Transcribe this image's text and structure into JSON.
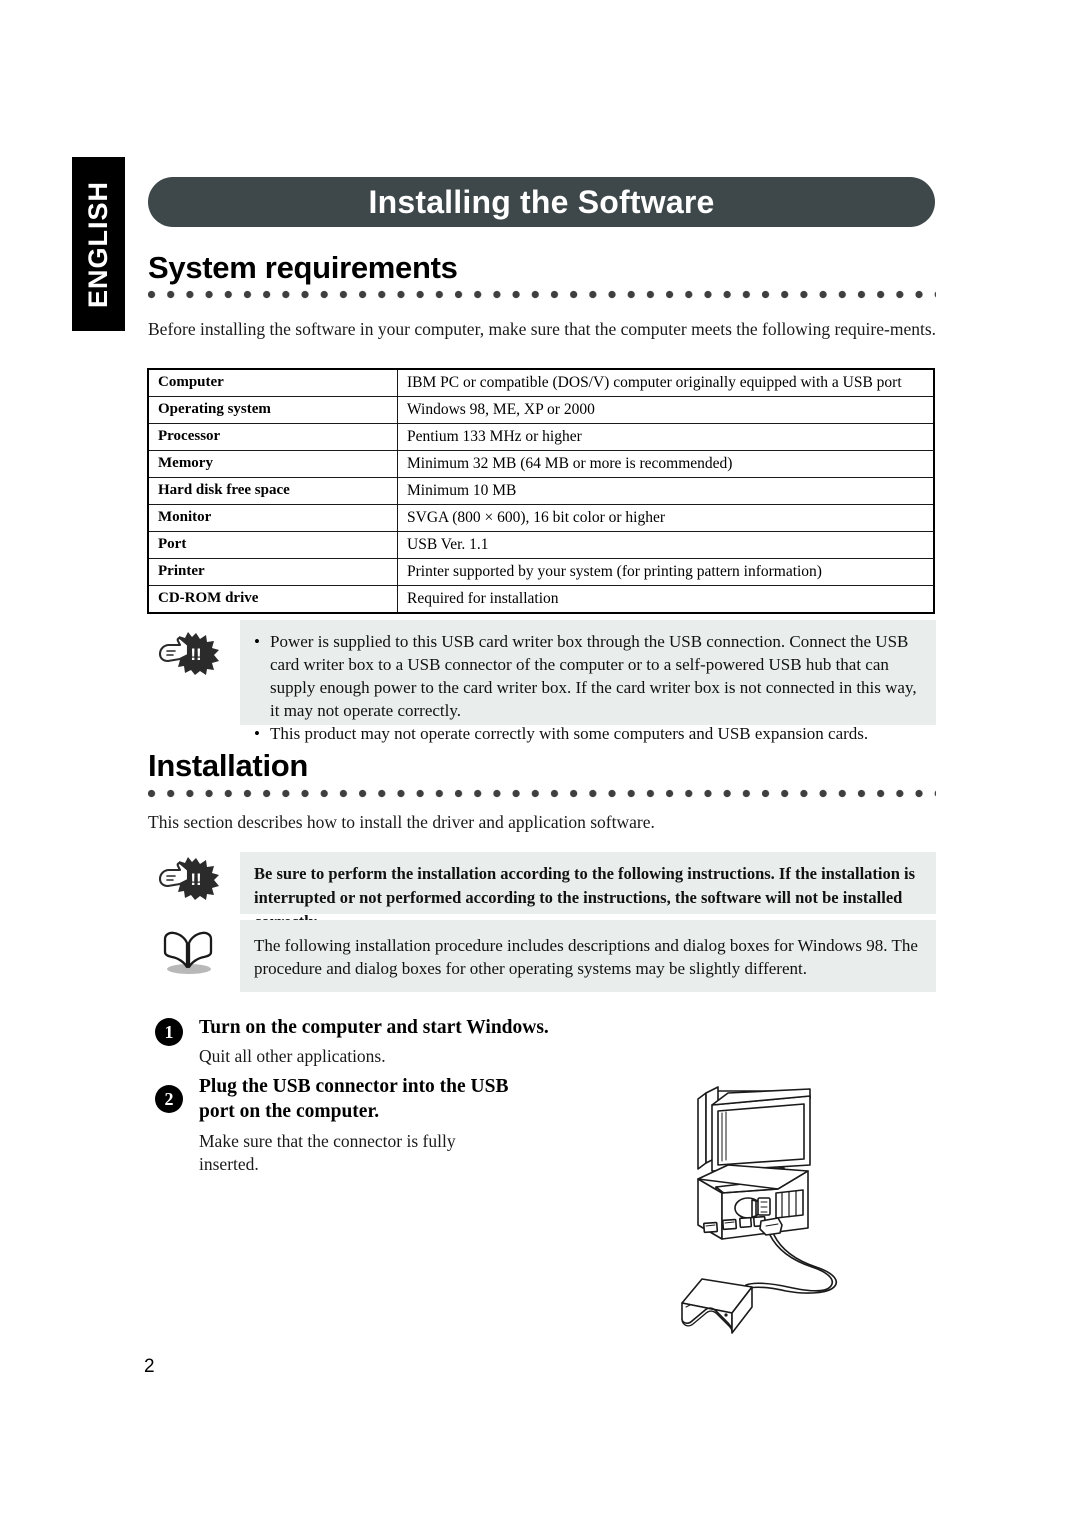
{
  "document": {
    "language_tab": "ENGLISH",
    "banner_title": "Installing the Software",
    "page_number": "2"
  },
  "sections": {
    "system_requirements": {
      "heading": "System requirements",
      "intro": "Before installing the software in your computer, make sure that the computer meets the following require-ments.",
      "table": {
        "rows": [
          {
            "key": "Computer",
            "value": "IBM PC or compatible (DOS/V) computer originally equipped with a USB port"
          },
          {
            "key": "Operating system",
            "value": "Windows 98, ME, XP or 2000"
          },
          {
            "key": "Processor",
            "value": "Pentium 133 MHz or higher"
          },
          {
            "key": "Memory",
            "value": "Minimum 32 MB (64 MB or more is recommended)"
          },
          {
            "key": "Hard disk free space",
            "value": "Minimum 10 MB"
          },
          {
            "key": "Monitor",
            "value": "SVGA (800 × 600), 16 bit color or higher"
          },
          {
            "key": "Port",
            "value": "USB Ver. 1.1"
          },
          {
            "key": "Printer",
            "value": "Printer supported by your system (for printing pattern information)"
          },
          {
            "key": "CD-ROM drive",
            "value": "Required for installation"
          }
        ]
      },
      "notice": {
        "icon": "warning-hand-icon",
        "bullet_marker": "•",
        "bullets": [
          "Power is supplied to this USB card writer box through the USB connection. Connect the USB card writer box to a USB connector of the computer or to a self-powered USB hub that can supply enough power to the card writer box. If the card writer box is not connected in this way, it may not operate correctly.",
          "This product may not operate correctly with some computers and USB expansion cards."
        ]
      }
    },
    "installation": {
      "heading": "Installation",
      "intro": "This section describes how to install the driver and application software.",
      "warning_notice": {
        "icon": "warning-hand-icon",
        "text": "Be sure to perform the installation according to the following instructions. If the installation is interrupted or not performed according to the instructions, the software will not be installed correctly."
      },
      "info_notice": {
        "icon": "open-book-icon",
        "text": "The following installation procedure includes descriptions and dialog boxes for Windows 98. The procedure and dialog boxes for other operating systems may be slightly different."
      },
      "steps": [
        {
          "number": "1",
          "title": "Turn on the computer and start Windows.",
          "body": "Quit all other applications."
        },
        {
          "number": "2",
          "title": "Plug the USB connector into the USB port on the computer.",
          "body": "Make sure that the connector is fully inserted."
        }
      ],
      "illustration": {
        "name": "computer-usb-card-writer-diagram",
        "elements": [
          "crt-monitor",
          "desktop-pc-tower",
          "usb-cable",
          "usb-card-writer-box"
        ]
      }
    }
  },
  "colors": {
    "banner_background": "#3e4749",
    "tab_background": "#000000",
    "notice_background": "#e9edec",
    "dot_rule": "#3f3f3f"
  }
}
